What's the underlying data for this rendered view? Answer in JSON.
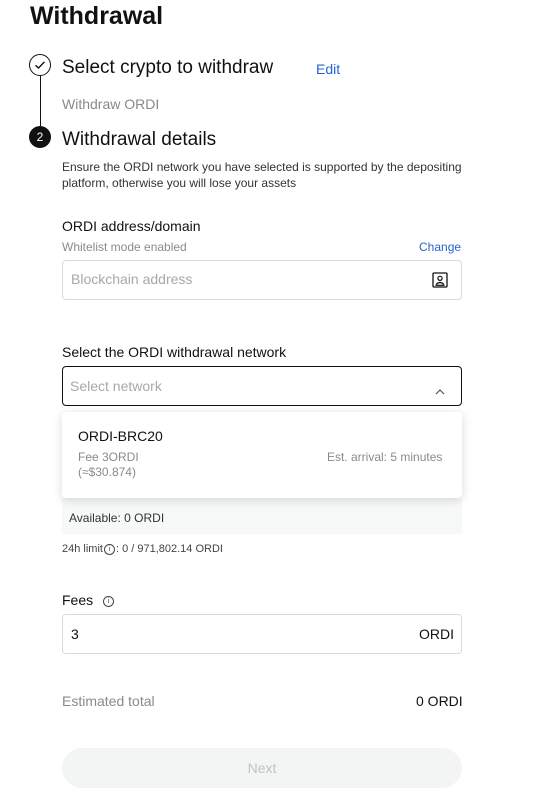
{
  "page": {
    "title": "Withdrawal"
  },
  "step1": {
    "title": "Select crypto to withdraw",
    "edit_label": "Edit",
    "subtitle": "Withdraw ORDI"
  },
  "step2": {
    "number": "2",
    "title": "Withdrawal details",
    "warning_line1": "Ensure the ORDI network you have selected is supported by the depositing",
    "warning_line2": "platform, otherwise you will lose your assets"
  },
  "address": {
    "label": "ORDI address/domain",
    "whitelist_note": "Whitelist mode enabled",
    "change_label": "Change",
    "placeholder": "Blockchain address",
    "icon": "address-book-icon"
  },
  "network": {
    "label": "Select the ORDI withdrawal network",
    "placeholder": "Select network",
    "options": [
      {
        "name": "ORDI-BRC20",
        "fee": "Fee 3ORDI",
        "fee_usd": "(≈$30.874)",
        "arrival": "Est. arrival: 5 minutes"
      }
    ]
  },
  "amount": {
    "available": "Available: 0 ORDI",
    "limit_label": "24h limit",
    "limit_value": ": 0 / 971,802.14 ORDI"
  },
  "fees": {
    "label": "Fees",
    "value": "3",
    "unit": "ORDI"
  },
  "total": {
    "label": "Estimated total",
    "value": "0 ORDI"
  },
  "actions": {
    "next_label": "Next"
  },
  "colors": {
    "accent": "#2463d6",
    "text": "#111111",
    "muted": "#8a8a8a"
  }
}
